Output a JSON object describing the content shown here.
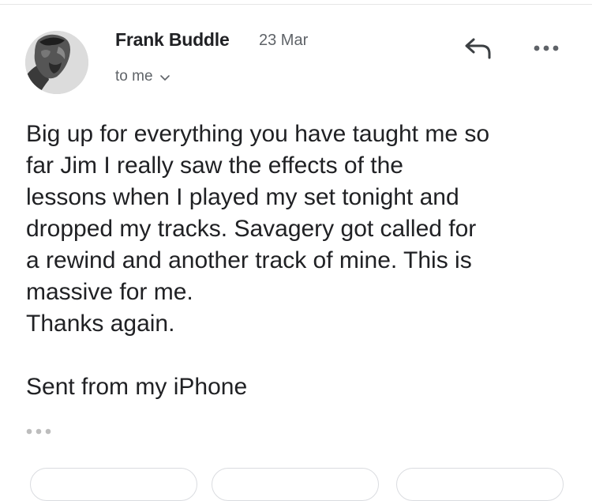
{
  "email": {
    "sender_name": "Frank Buddle",
    "date": "23 Mar",
    "recipient_label": "to me",
    "body_lines": [
      "Big up for everything you have taught me so",
      "far Jim I really saw the effects of the",
      "lessons when I played my set tonight and",
      "dropped my tracks. Savagery got called for",
      "a rewind and another track of mine. This is",
      "massive for me.",
      "Thanks again.",
      "",
      "Sent from my iPhone"
    ]
  },
  "icons": {
    "avatar": "avatar-photo",
    "recipient_toggle": "chevron-down-icon",
    "reply": "reply-arrow-icon",
    "more": "more-horizontal-icon",
    "quoted": "ellipsis-icon"
  },
  "colors": {
    "text_primary": "#202124",
    "text_secondary": "#5f6368",
    "chip_border": "#dadce0"
  }
}
